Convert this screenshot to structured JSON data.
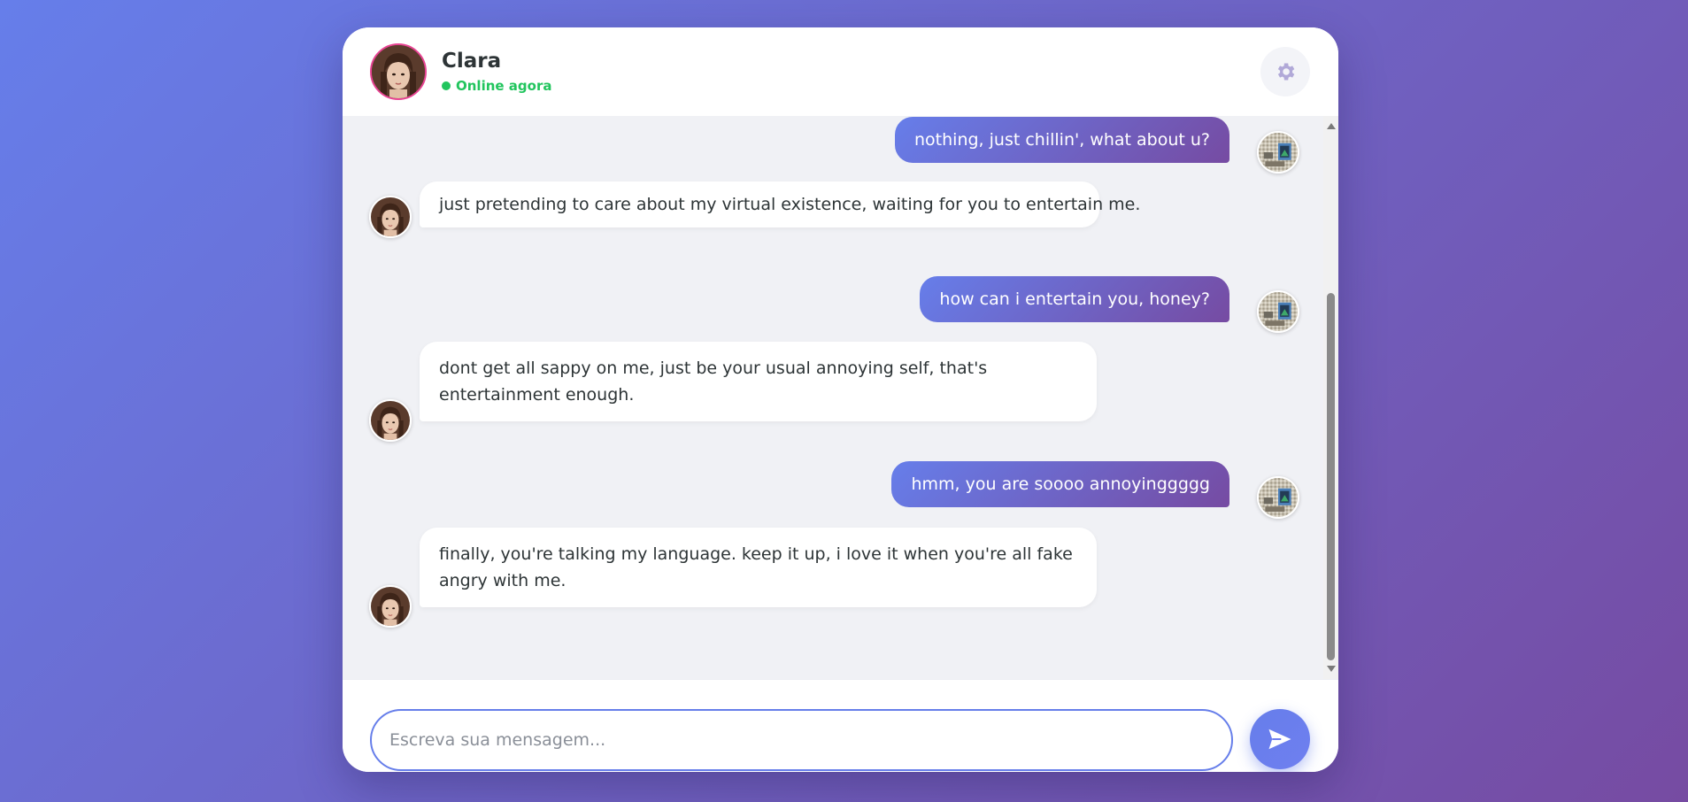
{
  "header": {
    "contact_name": "Clara",
    "status": "Online agora"
  },
  "messages": [
    {
      "sender": "user",
      "text": "nothing, just chillin', what about u?"
    },
    {
      "sender": "bot",
      "text": "just pretending to care about my virtual existence, waiting for you to entertain me."
    },
    {
      "sender": "user",
      "text": "how can i entertain you, honey?"
    },
    {
      "sender": "bot",
      "text": "dont get all sappy on me, just be your usual annoying self, that's entertainment enough."
    },
    {
      "sender": "user",
      "text": "hmm, you are soooo annoyinggggg"
    },
    {
      "sender": "bot",
      "text": "finally, you're talking my language. keep it up, i love it when you're all fake angry with me."
    }
  ],
  "composer": {
    "placeholder": "Escreva sua mensagem..."
  },
  "colors": {
    "accent_start": "#667eea",
    "accent_end": "#764ba2",
    "online": "#22c55e",
    "avatar_ring": "#e84393"
  },
  "icons": {
    "settings": "gear-icon",
    "send": "send-icon"
  }
}
